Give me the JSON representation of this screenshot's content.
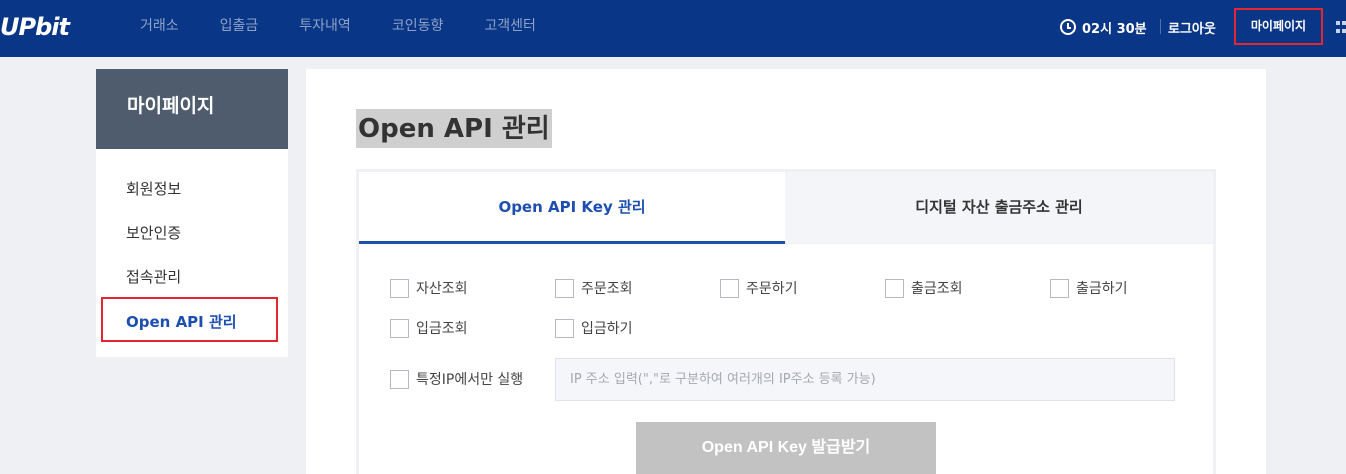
{
  "header": {
    "logo": "UPbit",
    "nav": [
      "거래소",
      "입출금",
      "투자내역",
      "코인동향",
      "고객센터"
    ],
    "timer": "02시 30분",
    "logout": "로그아웃",
    "mypage": "마이페이지"
  },
  "sidebar": {
    "title": "마이페이지",
    "items": [
      "회원정보",
      "보안인증",
      "접속관리"
    ],
    "active": "Open API 관리"
  },
  "main": {
    "title": "Open API 관리",
    "tabs": [
      "Open API Key 관리",
      "디지털 자산 출금주소 관리"
    ],
    "permissions": [
      "자산조회",
      "주문조회",
      "주문하기",
      "출금조회",
      "출금하기",
      "입금조회",
      "입금하기"
    ],
    "ip_only_label": "특정IP에서만 실행",
    "ip_placeholder": "IP 주소 입력(\",\"로 구분하여 여러개의 IP주소 등록 가능)",
    "issue_button": "Open API Key 발급받기"
  },
  "colors": {
    "nav_bg": "#093687",
    "accent": "#1d4fb0",
    "highlight_border": "#e3262f"
  }
}
